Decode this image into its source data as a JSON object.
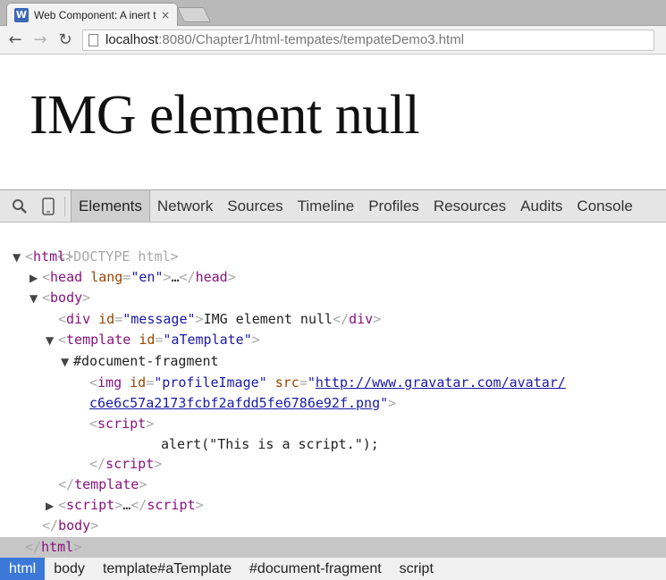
{
  "browser": {
    "tab_title": "Web Component: A inert t",
    "tab_close": "×",
    "favicon_letter": "W",
    "url_host": "localhost",
    "url_path": ":8080/Chapter1/html-tempates/tempateDemo3.html",
    "back_glyph": "←",
    "forward_glyph": "→",
    "reload_glyph": "↻"
  },
  "page": {
    "heading": "IMG element null"
  },
  "devtools": {
    "tabs": [
      "Elements",
      "Network",
      "Sources",
      "Timeline",
      "Profiles",
      "Resources",
      "Audits",
      "Console"
    ],
    "active_tab": "Elements",
    "icons": [
      "search-icon",
      "device-mode-icon"
    ]
  },
  "dom": {
    "doctype": "<!DOCTYPE html>",
    "html_open": "html",
    "head_tag": "head",
    "head_attr_name": "lang",
    "head_attr_value": "\"en\"",
    "head_ellipsis": "…",
    "body_tag": "body",
    "div_tag": "div",
    "div_attr_name": "id",
    "div_attr_value": "\"message\"",
    "div_text": "IMG element null",
    "template_tag": "template",
    "template_attr_name": "id",
    "template_attr_value": "\"aTemplate\"",
    "fragment": "#document-fragment",
    "img_tag": "img",
    "img_id_name": "id",
    "img_id_value": "\"profileImage\"",
    "img_src_name": "src",
    "img_src_url_1": "http://www.gravatar.com/avatar/",
    "img_src_url_2": "c6e6c57a2173fcbf2afdd5fe6786e92f.png",
    "script_tag": "script",
    "script_text": "alert(\"This is a script.\");",
    "script_ellipsis": "…"
  },
  "breadcrumbs": [
    "html",
    "body",
    "template#aTemplate",
    "#document-fragment",
    "script"
  ],
  "colors": {
    "tag": "#881280",
    "attr_name": "#994500",
    "attr_value": "#1a1aa6",
    "crumb_active": "#3b78d8"
  }
}
